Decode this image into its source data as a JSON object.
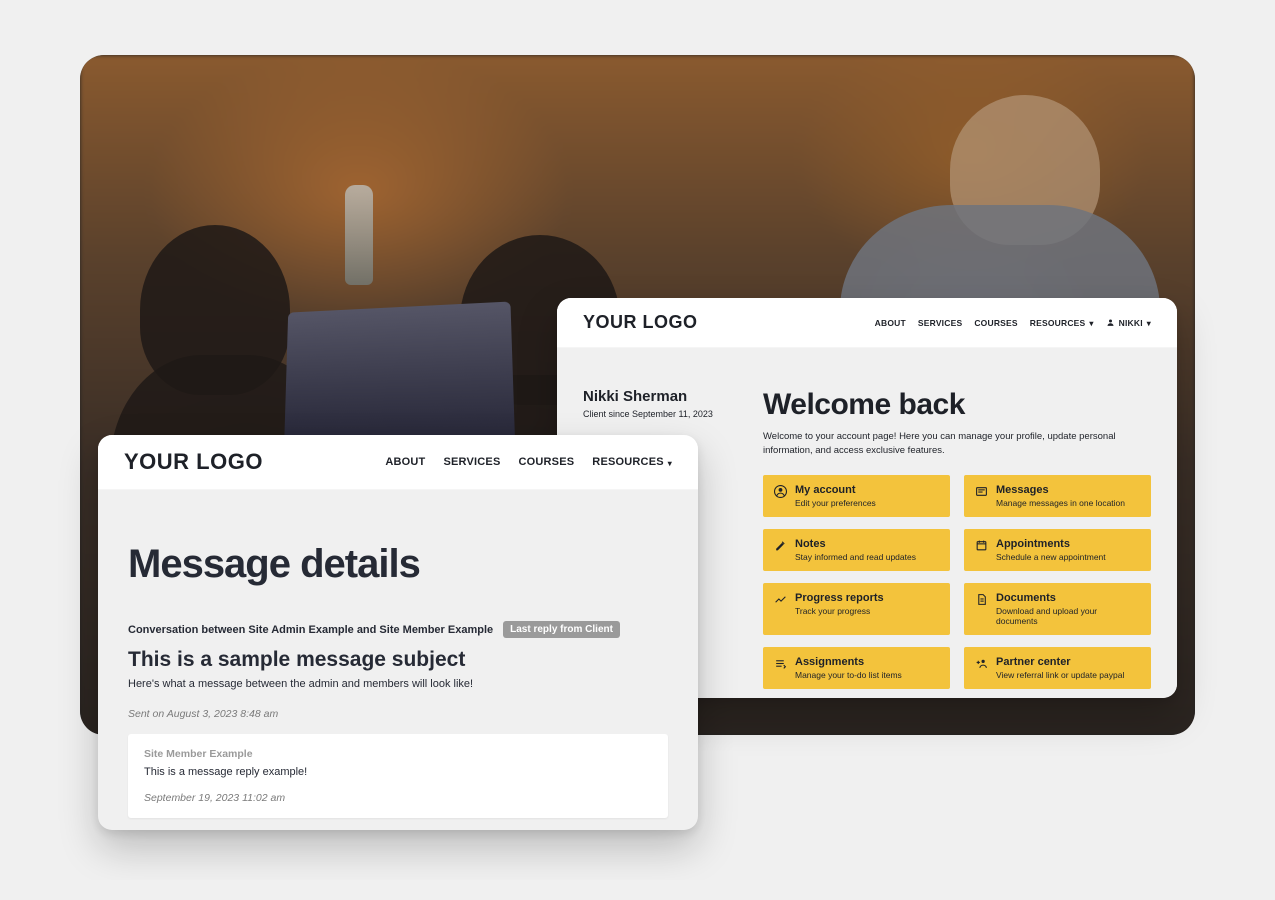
{
  "logo_text": "YOUR LOGO",
  "nav": {
    "about": "ABOUT",
    "services": "SERVICES",
    "courses": "COURSES",
    "resources": "RESOURCES",
    "user_name": "NIKKI"
  },
  "dashboard": {
    "member_name": "Nikki Sherman",
    "client_since": "Client since September 11, 2023",
    "welcome_title": "Welcome back",
    "welcome_intro": "Welcome to your account page! Here you can manage your profile, update personal information, and access exclusive features.",
    "tiles": [
      {
        "title": "My account",
        "desc": "Edit your preferences",
        "icon": "account"
      },
      {
        "title": "Messages",
        "desc": "Manage messages in one location",
        "icon": "messages"
      },
      {
        "title": "Notes",
        "desc": "Stay informed and read updates",
        "icon": "notes"
      },
      {
        "title": "Appointments",
        "desc": "Schedule a new appointment",
        "icon": "appointments"
      },
      {
        "title": "Progress reports",
        "desc": "Track your progress",
        "icon": "progress"
      },
      {
        "title": "Documents",
        "desc": "Download and upload your documents",
        "icon": "documents"
      },
      {
        "title": "Assignments",
        "desc": "Manage your to-do list items",
        "icon": "assignments"
      },
      {
        "title": "Partner center",
        "desc": "View referral link or update paypal",
        "icon": "partner"
      }
    ]
  },
  "message": {
    "page_title": "Message details",
    "conversation": "Conversation between Site Admin Example and Site Member Example",
    "badge": "Last reply from Client",
    "subject": "This is a sample message subject",
    "preview": "Here's what a message between the admin and members will look like!",
    "sent_on": "Sent on August 3, 2023 8:48 am",
    "reply": {
      "from": "Site Member Example",
      "text": "This is a message reply example!",
      "date": "September 19, 2023 11:02 am"
    }
  }
}
